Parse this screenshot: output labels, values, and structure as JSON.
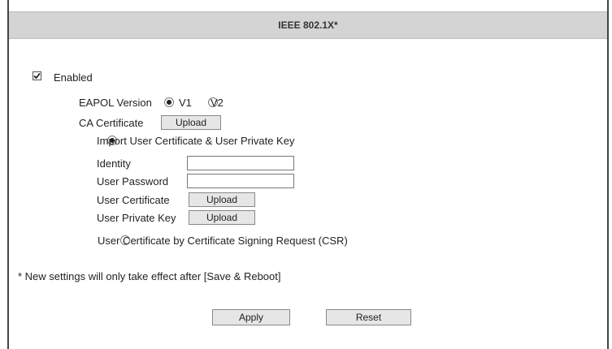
{
  "header": {
    "title": "IEEE 802.1X*"
  },
  "enabled": {
    "label": "Enabled",
    "checked": true
  },
  "eapol": {
    "label": "EAPOL Version",
    "options": [
      "V1",
      "V2"
    ],
    "selected": "V1"
  },
  "ca_certificate": {
    "label": "CA Certificate",
    "button": "Upload"
  },
  "import_option": {
    "label": "Import User Certificate & User Private Key",
    "selected": true,
    "identity": {
      "label": "Identity",
      "value": ""
    },
    "user_password": {
      "label": "User Password",
      "value": ""
    },
    "user_certificate": {
      "label": "User Certificate",
      "button": "Upload"
    },
    "user_private_key": {
      "label": "User Private Key",
      "button": "Upload"
    }
  },
  "csr_option": {
    "label": "User Certificate by Certificate Signing Request (CSR)",
    "selected": false
  },
  "note": "* New settings will only take effect after [Save & Reboot]",
  "actions": {
    "apply": "Apply",
    "reset": "Reset"
  }
}
